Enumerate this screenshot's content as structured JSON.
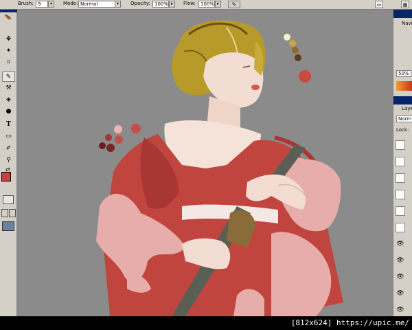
{
  "options": {
    "brush_label": "Brush:",
    "brush_value": "9",
    "mode_label": "Mode:",
    "mode_value": "Normal",
    "opacity_label": "Opacity:",
    "opacity_value": "100%",
    "flow_label": "Flow:",
    "flow_value": "100%"
  },
  "navigator": {
    "tab_label": "Navi",
    "zoom": "50%"
  },
  "layers": {
    "tab_label": "Laye",
    "blend_mode": "Norm",
    "lock_label": "Lock:"
  },
  "watermark": "[812x624] https://upic.me/",
  "colors": {
    "chrome": "#d4d0c8",
    "title_bar": "#0a246a",
    "canvas_bg": "#8b8b8b",
    "kimono_red": "#c0453f",
    "kimono_pink": "#e7adaa",
    "hair": "#b89a2a",
    "skin": "#f3ddd2",
    "sword": "#5a5f55",
    "grip": "#8a6c3a"
  },
  "swatches": {
    "hair_palette": [
      "#f3efd0",
      "#c9a640",
      "#8c6a28",
      "#5a3c1a",
      "#c84a40"
    ],
    "kimono_palette": [
      "#f0b4b0",
      "#c84c48",
      "#a03a38",
      "#6a1e1e",
      "#e8a0a0"
    ]
  },
  "icons": {
    "move": "move-icon",
    "marquee": "marquee-icon",
    "lasso": "lasso-icon",
    "magic_wand": "magic-wand-icon",
    "crop": "crop-icon",
    "brush": "brush-icon",
    "stamp": "stamp-icon",
    "eraser": "eraser-icon",
    "bucket": "bucket-icon",
    "dodge": "dodge-icon",
    "type": "type-icon",
    "shape": "shape-icon",
    "eyedropper": "eyedropper-icon",
    "zoom": "zoom-icon",
    "eye": "eye-icon"
  }
}
